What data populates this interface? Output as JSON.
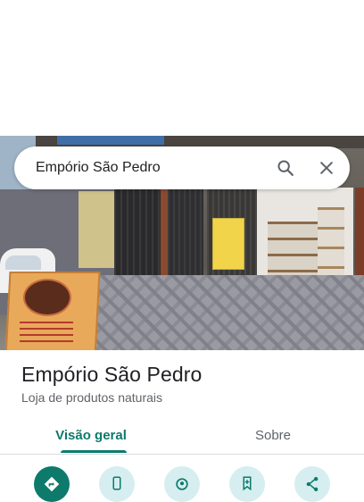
{
  "search": {
    "query": "Empório São Pedro"
  },
  "place": {
    "title": "Empório São Pedro",
    "category": "Loja de produtos naturais"
  },
  "tabs": [
    {
      "label": "Visão geral",
      "selected": true
    },
    {
      "label": "Sobre",
      "selected": false
    }
  ],
  "actions": [
    {
      "icon": "directions-icon"
    },
    {
      "icon": "phone-icon"
    },
    {
      "icon": "nearby-icon"
    },
    {
      "icon": "save-icon"
    },
    {
      "icon": "share-icon"
    }
  ],
  "colors": {
    "accent": "#0d7a6c",
    "action_bg": "#d6eef0",
    "text_primary": "#202124",
    "text_secondary": "#5f6368"
  }
}
